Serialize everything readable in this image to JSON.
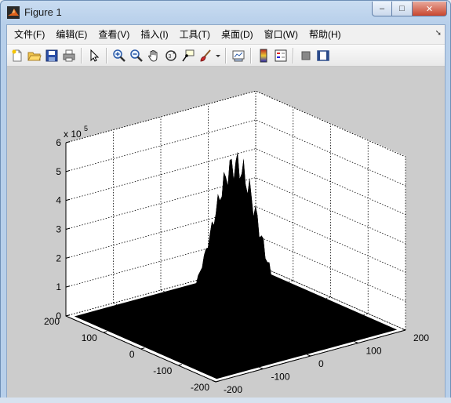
{
  "window": {
    "title": "Figure 1",
    "minimize": "‒",
    "maximize": "□",
    "close": "✕"
  },
  "menu": [
    "文件(F)",
    "编辑(E)",
    "查看(V)",
    "插入(I)",
    "工具(T)",
    "桌面(D)",
    "窗口(W)",
    "帮助(H)"
  ],
  "menu_pin_icon": "pin-arrow-icon",
  "toolbar": [
    "new-figure-icon",
    "open-file-icon",
    "save-figure-icon",
    "print-figure-icon",
    "edit-plot-arrow-icon",
    "zoom-in-icon",
    "zoom-out-icon",
    "pan-hand-icon",
    "rotate-3d-icon",
    "data-cursor-icon",
    "brush-data-icon",
    "brush-dropdown-icon",
    "link-plot-icon",
    "insert-colorbar-icon",
    "insert-legend-icon",
    "hide-plot-tools-icon",
    "show-plot-tools-icon"
  ],
  "chart_data": {
    "type": "surface",
    "title": "",
    "z_exponent_label": "x 10",
    "z_exponent_power": "5",
    "z_ticks": [
      "0",
      "1",
      "2",
      "3",
      "4",
      "5",
      "6"
    ],
    "z_range": [
      0,
      600000
    ],
    "x_ticks": [
      "-200",
      "-100",
      "0",
      "100",
      "200"
    ],
    "x_range": [
      -200,
      200
    ],
    "y_ticks": [
      "200",
      "100",
      "0",
      "-100",
      "-200"
    ],
    "y_range": [
      -200,
      200
    ],
    "grid": true,
    "surface_color": "#000000",
    "peak_value": 550000,
    "peak_location": [
      0,
      0
    ],
    "background_color": "#cccccc",
    "axes_color": "#ffffff"
  }
}
